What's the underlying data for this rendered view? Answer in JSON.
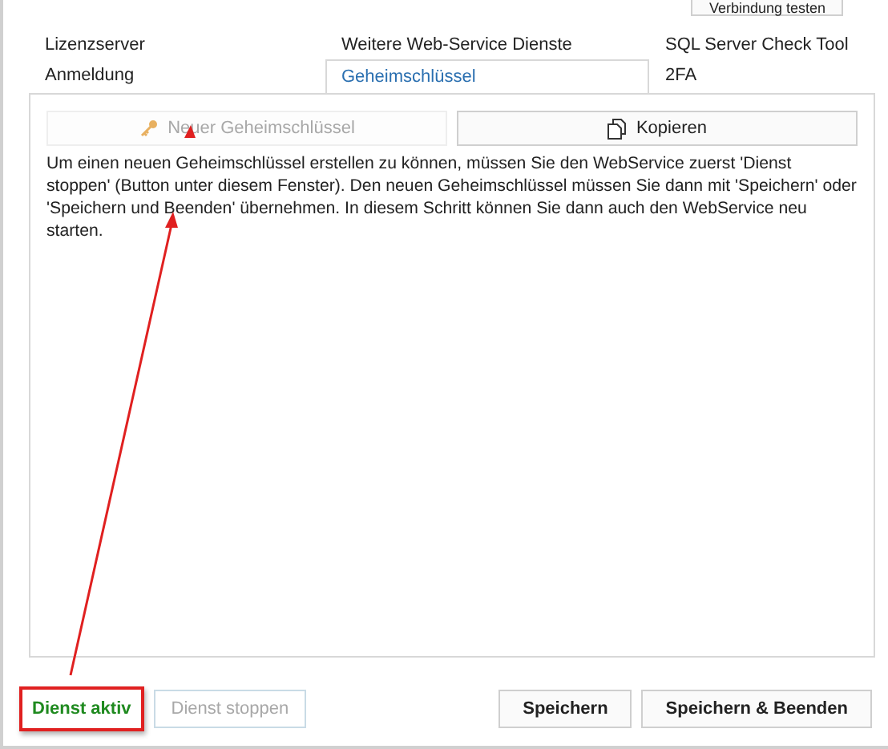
{
  "top_button": {
    "label": "Verbindung testen"
  },
  "tab_rows": [
    {
      "tabs": [
        {
          "label": "Lizenzserver",
          "selected": false
        },
        {
          "label": "Weitere Web-Service Dienste",
          "selected": false
        },
        {
          "label": "SQL Server Check Tool",
          "selected": false
        }
      ]
    },
    {
      "tabs": [
        {
          "label": "Anmeldung",
          "selected": false
        },
        {
          "label": "Geheimschlüssel",
          "selected": true
        },
        {
          "label": "2FA",
          "selected": false
        }
      ]
    }
  ],
  "panel_buttons": [
    {
      "label": "Neuer Geheimschlüssel",
      "kind": "key",
      "disabled": true
    },
    {
      "label": "Kopieren",
      "kind": "copy",
      "disabled": false
    }
  ],
  "description": "Um einen neuen Geheimschlüssel erstellen zu können, müssen Sie den WebService zuerst 'Dienst stoppen' (Button unter diesem Fenster). Den neuen Geheimschlüssel müssen Sie dann mit 'Speichern' oder 'Speichern und Beenden' übernehmen. In diesem Schritt können Sie dann auch den WebService neu starten.",
  "service": {
    "status": "Dienst aktiv",
    "active": true,
    "highlighted": true,
    "stop_button": {
      "label": "Dienst stoppen",
      "disabled": true
    }
  },
  "footer_buttons": [
    {
      "label": "Speichern"
    },
    {
      "label": "Speichern & Beenden"
    }
  ]
}
